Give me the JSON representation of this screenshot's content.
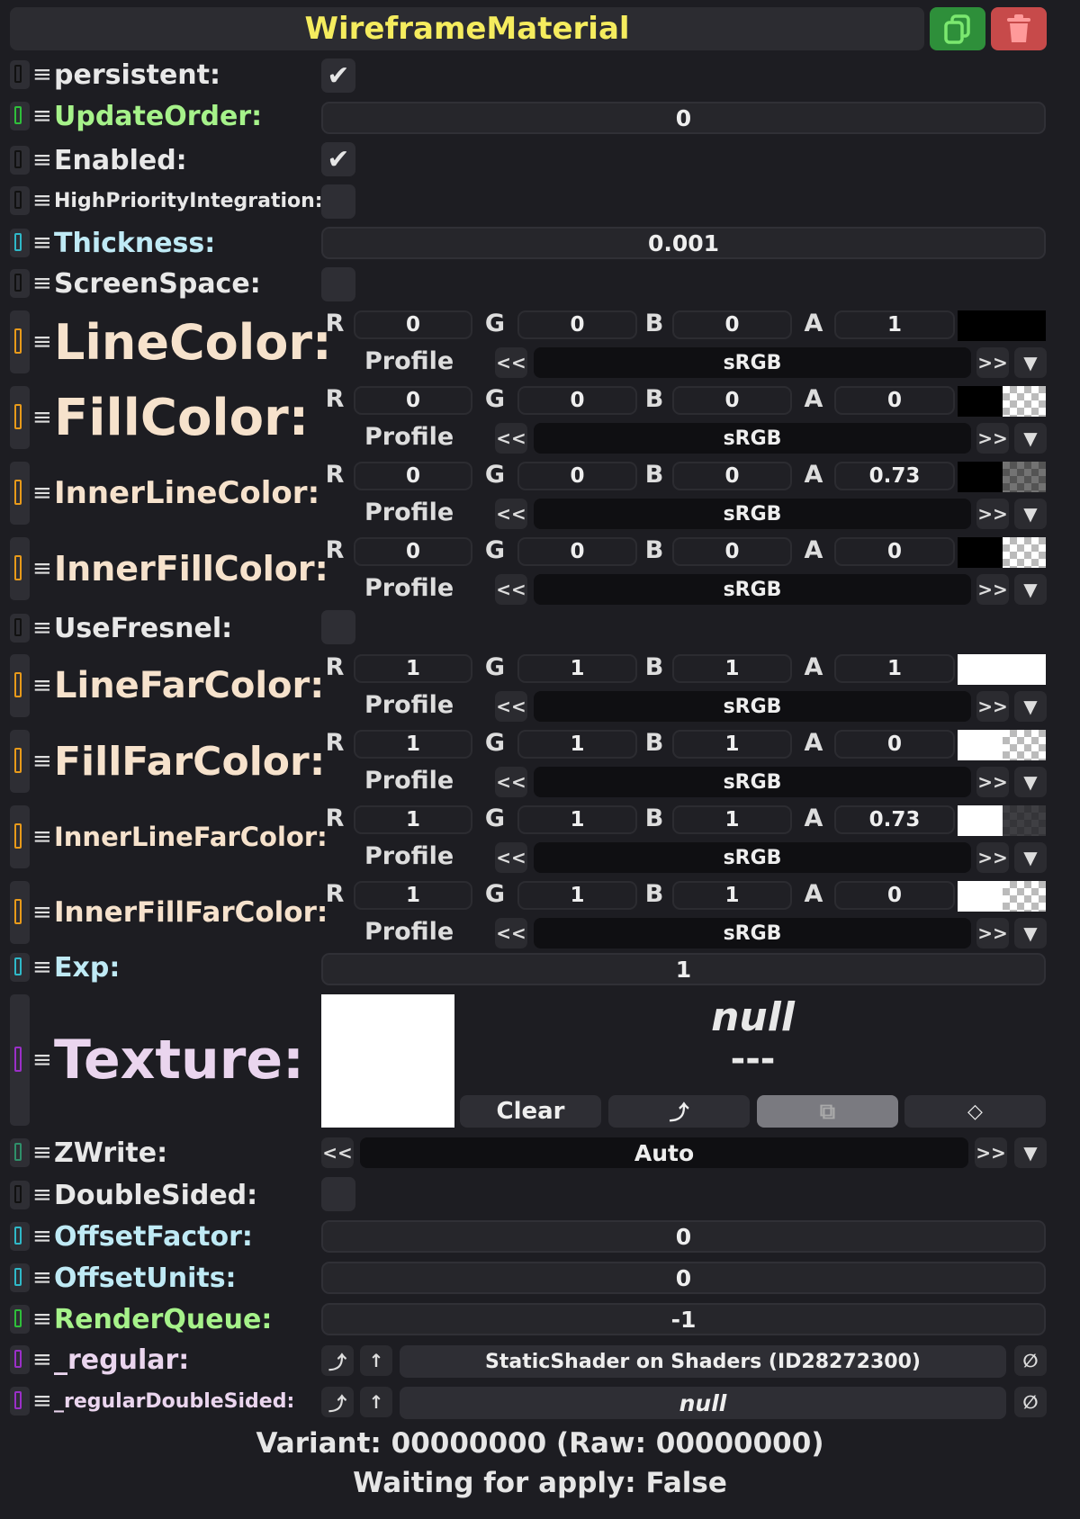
{
  "header": {
    "title": "WireframeMaterial"
  },
  "fields": {
    "persistent": {
      "label": "persistent:",
      "checked": true
    },
    "update_order": {
      "label": "UpdateOrder:",
      "value": "0"
    },
    "enabled": {
      "label": "Enabled:",
      "checked": true
    },
    "high_priority": {
      "label": "HighPriorityIntegration:",
      "checked": false
    },
    "thickness": {
      "label": "Thickness:",
      "value": "0.001"
    },
    "screen_space": {
      "label": "ScreenSpace:",
      "checked": false
    },
    "use_fresnel": {
      "label": "UseFresnel:",
      "checked": false
    },
    "exp": {
      "label": "Exp:",
      "value": "1"
    },
    "zwrite": {
      "label": "ZWrite:",
      "value": "Auto"
    },
    "double_sided": {
      "label": "DoubleSided:",
      "checked": false
    },
    "offset_factor": {
      "label": "OffsetFactor:",
      "value": "0"
    },
    "offset_units": {
      "label": "OffsetUnits:",
      "value": "0"
    },
    "render_queue": {
      "label": "RenderQueue:",
      "value": "-1"
    },
    "regular": {
      "label": "_regular:",
      "value": "StaticShader on Shaders (ID28272300)"
    },
    "regular_double_sided": {
      "label": "_regularDoubleSided:",
      "value": "null"
    }
  },
  "channel_letters": {
    "r": "R",
    "g": "G",
    "b": "B",
    "a": "A"
  },
  "profile_label": "Profile",
  "profile_prev": "<<",
  "profile_next": ">>",
  "colors": [
    {
      "label": "LineColor:",
      "r": "0",
      "g": "0",
      "b": "0",
      "a": "1",
      "profile": "sRGB",
      "swatch": "#000000"
    },
    {
      "label": "FillColor:",
      "r": "0",
      "g": "0",
      "b": "0",
      "a": "0",
      "profile": "sRGB",
      "swatch": "#000000"
    },
    {
      "label": "InnerLineColor:",
      "r": "0",
      "g": "0",
      "b": "0",
      "a": "0.73",
      "profile": "sRGB",
      "swatch": "#000000"
    },
    {
      "label": "InnerFillColor:",
      "r": "0",
      "g": "0",
      "b": "0",
      "a": "0",
      "profile": "sRGB",
      "swatch": "#000000"
    },
    {
      "label": "LineFarColor:",
      "r": "1",
      "g": "1",
      "b": "1",
      "a": "1",
      "profile": "sRGB",
      "swatch": "#ffffff"
    },
    {
      "label": "FillFarColor:",
      "r": "1",
      "g": "1",
      "b": "1",
      "a": "0",
      "profile": "sRGB",
      "swatch": "#ffffff"
    },
    {
      "label": "InnerLineFarColor:",
      "r": "1",
      "g": "1",
      "b": "1",
      "a": "0.73",
      "profile": "sRGB",
      "swatch": "#ffffff"
    },
    {
      "label": "InnerFillFarColor:",
      "r": "1",
      "g": "1",
      "b": "1",
      "a": "0",
      "profile": "sRGB",
      "swatch": "#ffffff"
    }
  ],
  "texture": {
    "label": "Texture:",
    "value": "null",
    "dashes": "---",
    "clear_label": "Clear"
  },
  "footer": {
    "variant": "Variant: 00000000 (Raw: 00000000)",
    "waiting": "Waiting for apply: False"
  },
  "theme": {
    "title_color": "#f5ec5e",
    "duplicate_button": "#2e8f3a",
    "delete_button": "#c74a4a"
  }
}
